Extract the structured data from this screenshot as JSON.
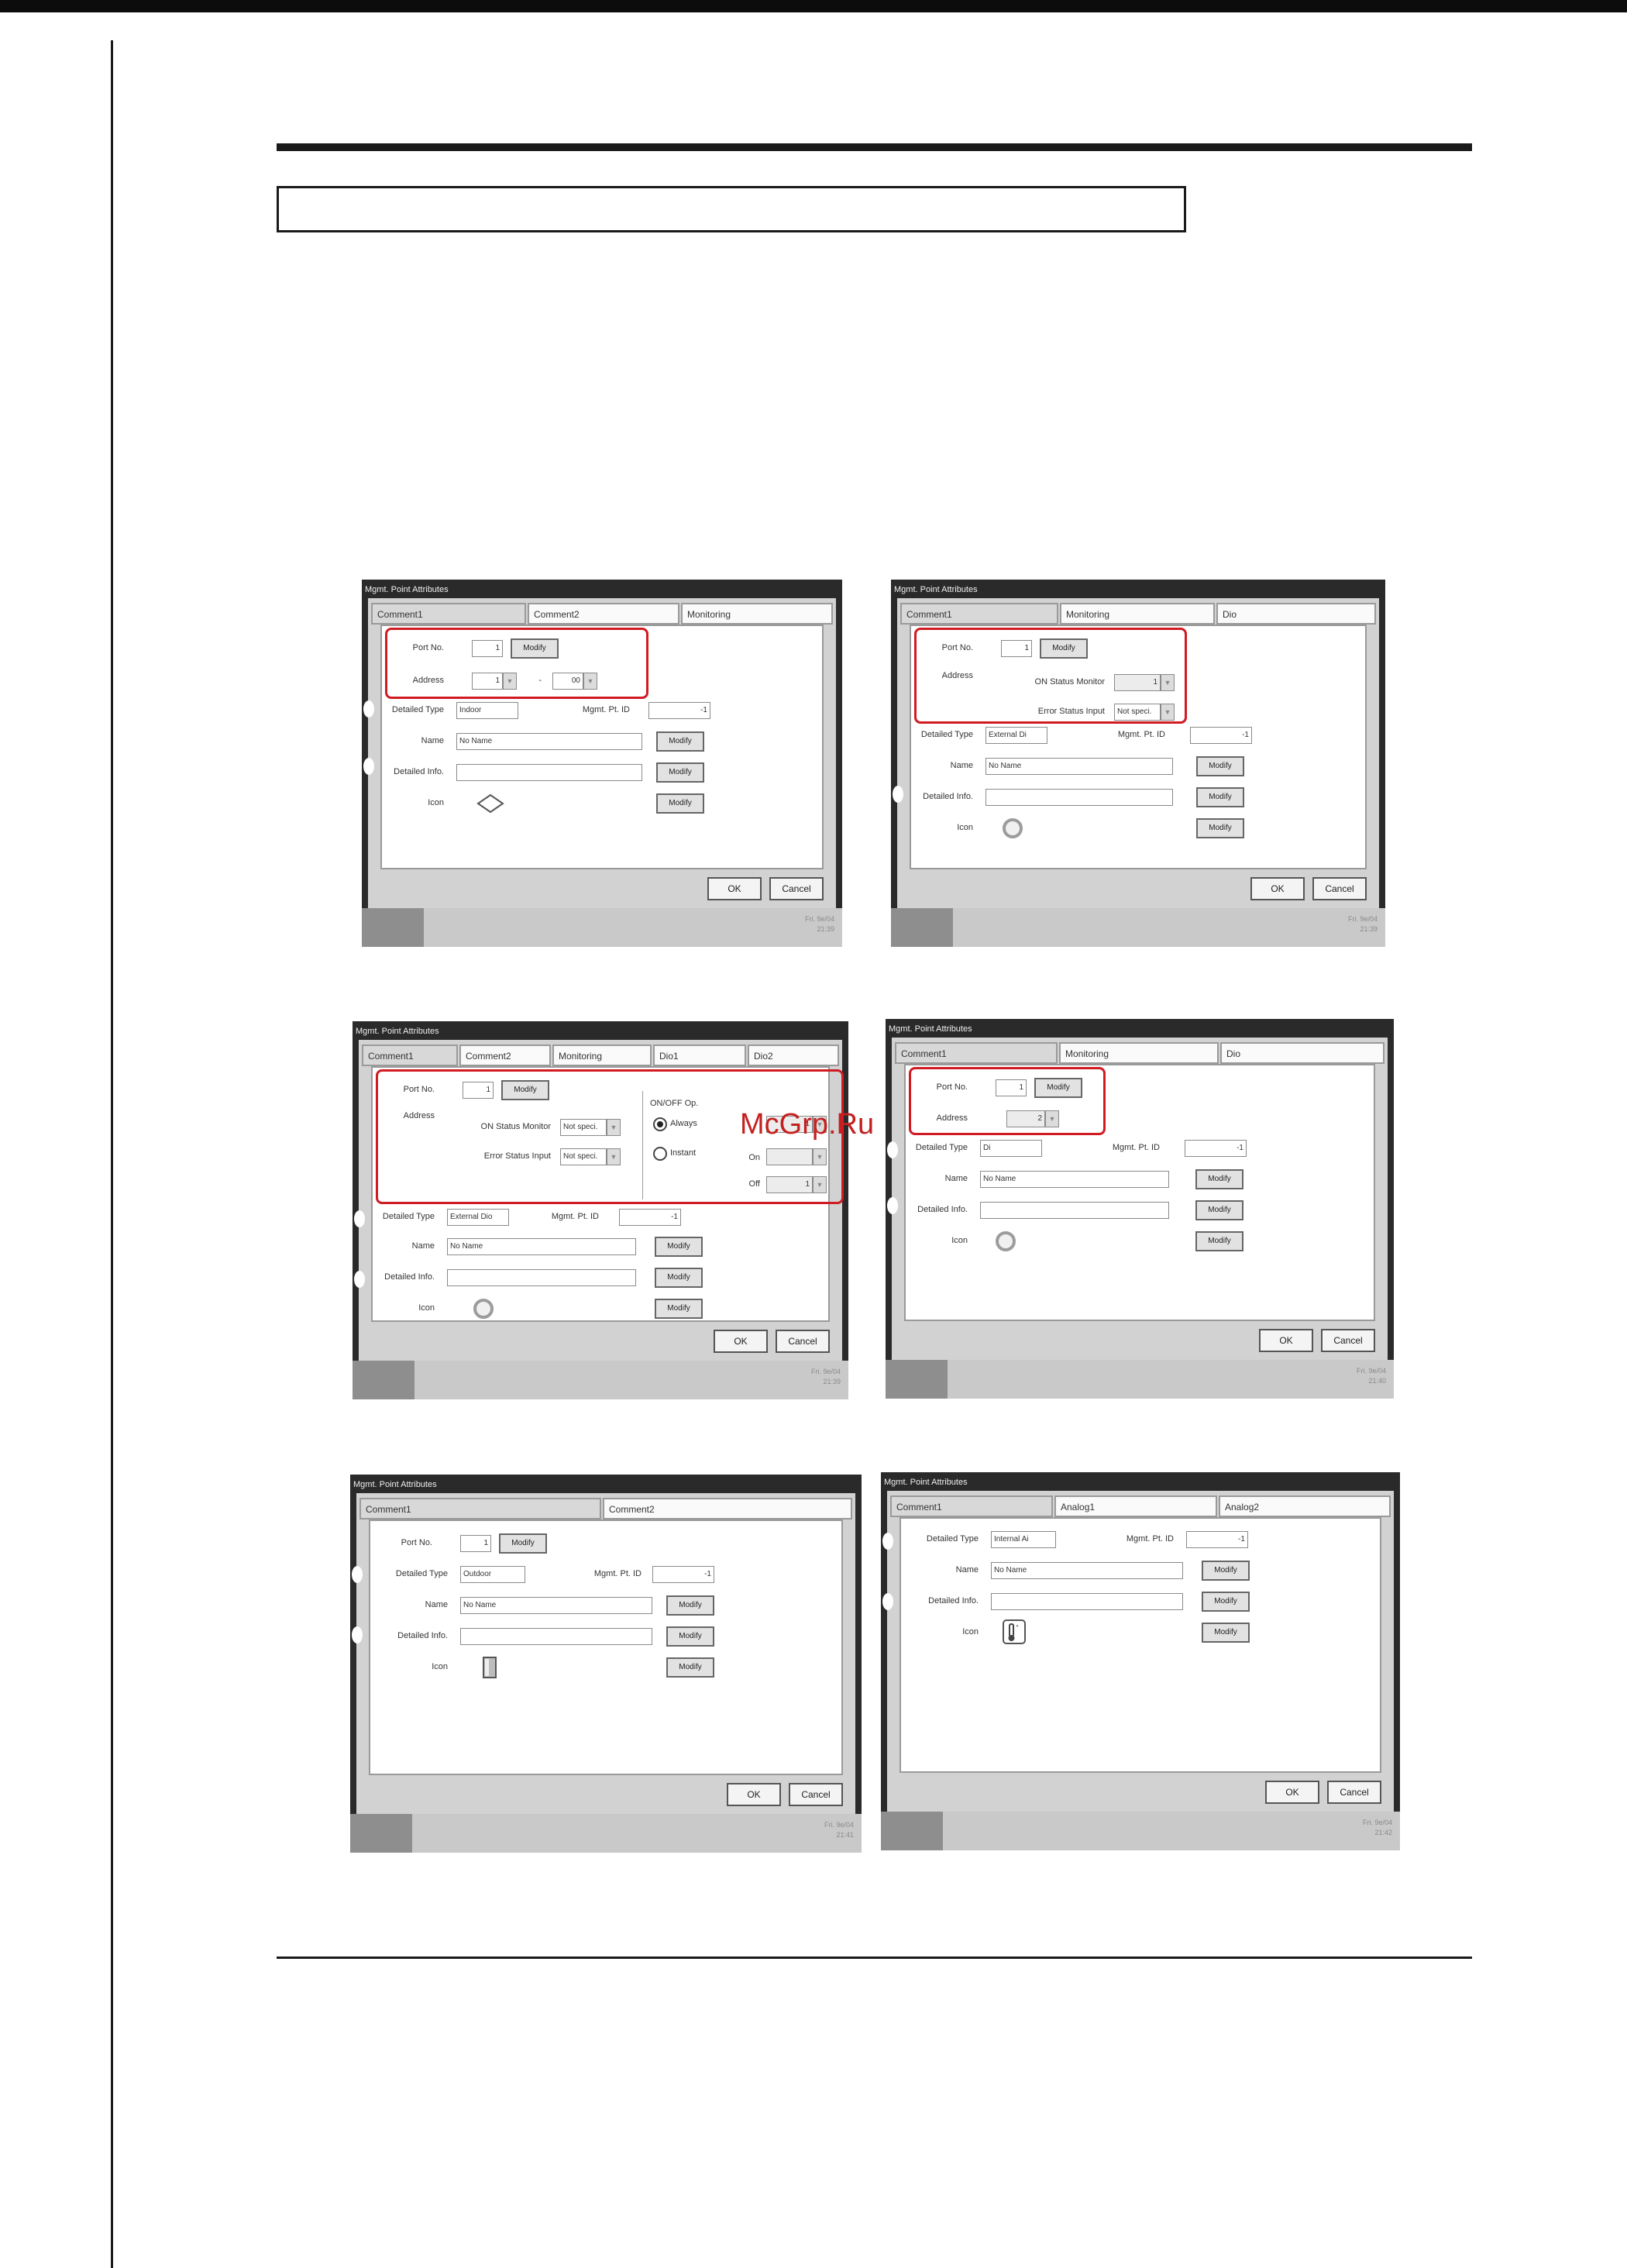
{
  "shots": [
    {
      "title": "Mgmt. Point Attributes",
      "tabs": [
        "Comment1",
        "Comment2",
        "Monitoring"
      ],
      "labels": {
        "port": "Port No.",
        "address": "Address",
        "dtype": "Detailed Type",
        "mgmt_id": "Mgmt. Pt. ID",
        "name": "Name",
        "info": "Detailed Info.",
        "icon": "Icon",
        "dash": "-"
      },
      "values": {
        "port": "1",
        "addr1": "1",
        "addr2": "00",
        "dtype": "Indoor",
        "mgmt_id": "-1",
        "name": "No Name",
        "info": ""
      },
      "buttons": {
        "modify": "Modify",
        "ok": "OK",
        "cancel": "Cancel"
      },
      "icon": "diamond-icon",
      "datetime": [
        "Fri. 9e/04",
        "21:39"
      ]
    },
    {
      "title": "Mgmt. Point Attributes",
      "tabs": [
        "Comment1",
        "Monitoring",
        "Dio"
      ],
      "labels": {
        "port": "Port No.",
        "address": "Address",
        "on_status": "ON Status Monitor",
        "err_status": "Error Status Input",
        "dtype": "Detailed Type",
        "mgmt_id": "Mgmt. Pt. ID",
        "name": "Name",
        "info": "Detailed Info.",
        "icon": "Icon"
      },
      "values": {
        "port": "1",
        "on_status": "1",
        "err_status": "Not speci.",
        "dtype": "External Di",
        "mgmt_id": "-1",
        "name": "No Name",
        "info": ""
      },
      "buttons": {
        "modify": "Modify",
        "ok": "OK",
        "cancel": "Cancel"
      },
      "icon": "ring-icon",
      "datetime": [
        "Fri. 9e/04",
        "21:39"
      ]
    },
    {
      "title": "Mgmt. Point Attributes",
      "tabs": [
        "Comment1",
        "Comment2",
        "Monitoring",
        "Dio1",
        "Dio2"
      ],
      "labels": {
        "port": "Port No.",
        "address": "Address",
        "on_status": "ON Status Monitor",
        "err_status": "Error Status Input",
        "onoff": "ON/OFF Op.",
        "always": "Always",
        "instant": "Instant",
        "on": "On",
        "off": "Off",
        "dtype": "Detailed Type",
        "mgmt_id": "Mgmt. Pt. ID",
        "name": "Name",
        "info": "Detailed Info.",
        "icon": "Icon"
      },
      "values": {
        "port": "1",
        "on_status": "Not speci.",
        "err_status": "Not speci.",
        "always_val": "1",
        "on_val": "",
        "off_val": "1",
        "dtype": "External Dio",
        "mgmt_id": "-1",
        "name": "No Name",
        "info": ""
      },
      "buttons": {
        "modify": "Modify",
        "ok": "OK",
        "cancel": "Cancel"
      },
      "icon": "ring-icon",
      "datetime": [
        "Fri. 9e/04",
        "21:39"
      ]
    },
    {
      "title": "Mgmt. Point Attributes",
      "tabs": [
        "Comment1",
        "Monitoring",
        "Dio"
      ],
      "labels": {
        "port": "Port No.",
        "address": "Address",
        "dtype": "Detailed Type",
        "mgmt_id": "Mgmt. Pt. ID",
        "name": "Name",
        "info": "Detailed Info.",
        "icon": "Icon"
      },
      "values": {
        "port": "1",
        "addr": "2",
        "dtype": "Di",
        "mgmt_id": "-1",
        "name": "No Name",
        "info": ""
      },
      "buttons": {
        "modify": "Modify",
        "ok": "OK",
        "cancel": "Cancel"
      },
      "icon": "ring-icon",
      "datetime": [
        "Fri. 9e/04",
        "21:40"
      ]
    },
    {
      "title": "Mgmt. Point Attributes",
      "tabs": [
        "Comment1",
        "Comment2"
      ],
      "labels": {
        "port": "Port No.",
        "dtype": "Detailed Type",
        "mgmt_id": "Mgmt. Pt. ID",
        "name": "Name",
        "info": "Detailed Info.",
        "icon": "Icon"
      },
      "values": {
        "port": "1",
        "dtype": "Outdoor",
        "mgmt_id": "-1",
        "name": "No Name",
        "info": ""
      },
      "buttons": {
        "modify": "Modify",
        "ok": "OK",
        "cancel": "Cancel"
      },
      "icon": "outdoor-unit-icon",
      "datetime": [
        "Fri. 9e/04",
        "21:41"
      ]
    },
    {
      "title": "Mgmt. Point Attributes",
      "tabs": [
        "Comment1",
        "Analog1",
        "Analog2"
      ],
      "labels": {
        "dtype": "Detailed Type",
        "mgmt_id": "Mgmt. Pt. ID",
        "name": "Name",
        "info": "Detailed Info.",
        "icon": "Icon"
      },
      "values": {
        "dtype": "Internal Ai",
        "mgmt_id": "-1",
        "name": "No Name",
        "info": ""
      },
      "buttons": {
        "modify": "Modify",
        "ok": "OK",
        "cancel": "Cancel"
      },
      "icon": "thermometer-icon",
      "datetime": [
        "Fri. 9e/04",
        "21:42"
      ]
    }
  ],
  "watermark": "McGrp.Ru",
  "colors": {
    "highlight": "#d11b23",
    "frame": "#2a2a2a",
    "panel": "#d2d2d2"
  }
}
